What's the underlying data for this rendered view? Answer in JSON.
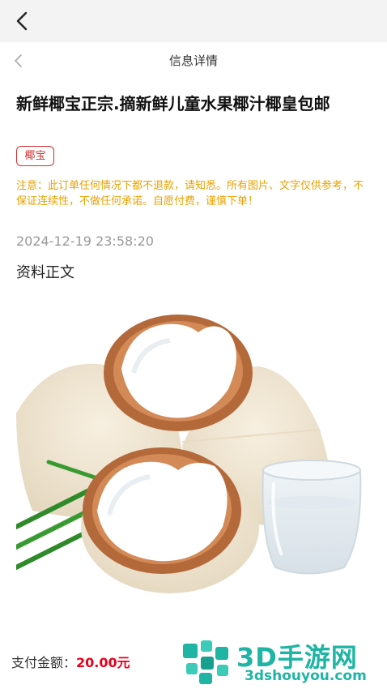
{
  "nav": {
    "title": "信息详情"
  },
  "post": {
    "title": "新鲜椰宝正宗.摘新鲜儿童水果椰汁椰皇包邮",
    "tag": "椰宝",
    "notice": "注意：此订单任何情况下都不退款，请知悉。所有图片、文字仅供参考，不保证连续性，不做任何承诺。自愿付费，谨慎下单！",
    "timestamp": "2024-12-19 23:58:20",
    "section_heading": "资料正文"
  },
  "payment": {
    "label": "支付金额：",
    "amount": "20.00元"
  },
  "watermark": {
    "brand": "3D手游网",
    "site": "3dshouyou.com"
  },
  "colors": {
    "accent_red": "#d32f2f",
    "notice_orange": "#e8a200",
    "price_red": "#e8001b",
    "watermark_teal": "#1fb4a4"
  },
  "icons": [
    "chevron-left-icon",
    "back-arrow-icon",
    "coconut-image",
    "watermark-logo"
  ]
}
